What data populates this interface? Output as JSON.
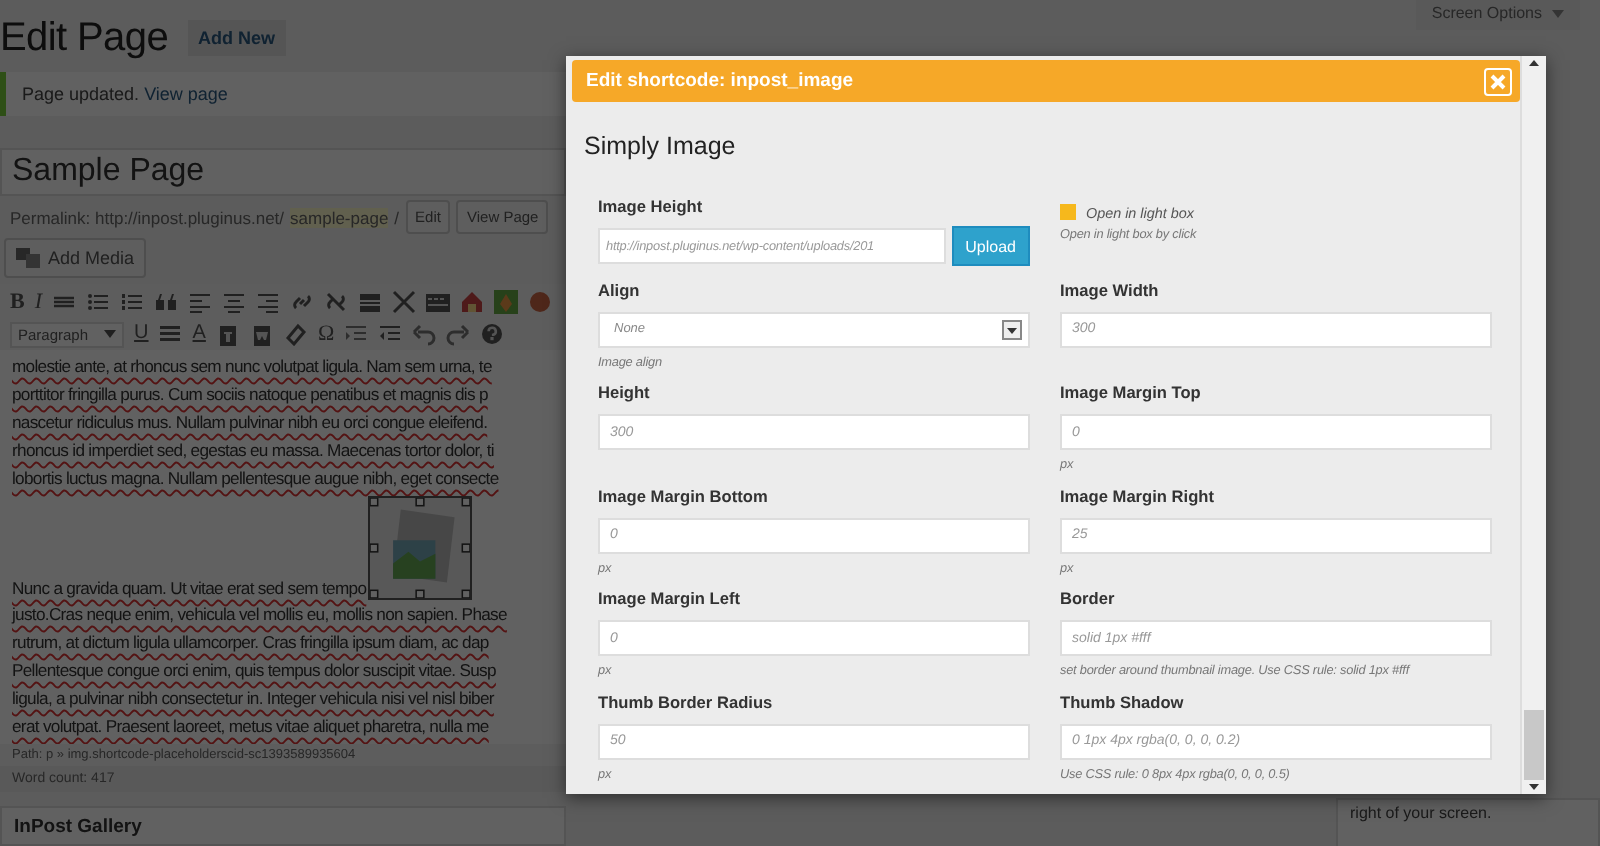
{
  "header": {
    "title": "Edit Page",
    "add_new": "Add New",
    "screen_options": "Screen Options"
  },
  "notice": {
    "text": "Page updated.",
    "link": "View page"
  },
  "post_title": "Sample Page",
  "permalink": {
    "label": "Permalink: http://inpost.pluginus.net/",
    "slug": "sample-page",
    "trail": "/",
    "buttons": [
      "Edit",
      "View Page"
    ]
  },
  "add_media": "Add Media",
  "toolbar": {
    "bold": "B",
    "italic": "I",
    "format_select": "Paragraph",
    "underline": "U",
    "text_color": "A",
    "special_char": "Ω"
  },
  "editor_paragraphs": [
    [
      "molestie ante, at rhoncus sem nunc volutpat ligula. Nam sem urna, te",
      "porttitor fringilla purus. Cum sociis natoque penatibus et magnis dis p",
      "nascetur ridiculus mus. Nullam pulvinar nibh eu orci congue eleifend.",
      "rhoncus id imperdiet sed, egestas eu massa. Maecenas tortor dolor, ti",
      "lobortis luctus magna. Nullam pellentesque augue nibh, eget consecte"
    ],
    [
      "Nunc a gravida quam. Ut vitae erat sed sem tempo",
      "justo.Cras neque enim, vehicula vel mollis eu, mollis non sapien. Phase",
      "rutrum, at dictum ligula ullamcorper. Cras fringilla ipsum diam, ac dap",
      "Pellentesque congue orci enim, quis tempus dolor suscipit vitae. Susp",
      "ligula, a pulvinar nibh consectetur in. Integer vehicula nisi vel nisl biber",
      "erat volutpat. Praesent laoreet, metus vitae aliquet pharetra, nulla me"
    ]
  ],
  "path": "Path: p » img.shortcode-placeholderscid-sc1393589935604",
  "word_count": "Word count: 417",
  "gallery_box": "InPost Gallery",
  "side_note": "right of your screen.",
  "modal": {
    "title": "Edit shortcode: inpost_image",
    "heading": "Simply Image",
    "fields": [
      {
        "kind": "upload",
        "label": "Image Height",
        "placeholder": "http://inpost.pluginus.net/wp-content/uploads/201",
        "button": "Upload"
      },
      {
        "kind": "checkbox",
        "label": "Open in light box",
        "checked": true,
        "hint": "Open in light box by click"
      },
      {
        "kind": "select",
        "label": "Align",
        "value": "None",
        "hint": "Image align"
      },
      {
        "kind": "text",
        "label": "Image Width",
        "placeholder": "300"
      },
      {
        "kind": "text",
        "label": "Height",
        "placeholder": "300"
      },
      {
        "kind": "text",
        "label": "Image Margin Top",
        "placeholder": "0",
        "hint": "px"
      },
      {
        "kind": "text",
        "label": "Image Margin Bottom",
        "placeholder": "0",
        "hint": "px"
      },
      {
        "kind": "text",
        "label": "Image Margin Right",
        "placeholder": "25",
        "hint": "px"
      },
      {
        "kind": "text",
        "label": "Image Margin Left",
        "placeholder": "0",
        "hint": "px"
      },
      {
        "kind": "text",
        "label": "Border",
        "placeholder": "solid 1px #fff",
        "hint": "set border around thumbnail image. Use CSS rule: solid 1px #fff"
      },
      {
        "kind": "text",
        "label": "Thumb Border Radius",
        "placeholder": "50",
        "hint": "px"
      },
      {
        "kind": "text",
        "label": "Thumb Shadow",
        "placeholder": "0 1px 4px rgba(0, 0, 0, 0.2)",
        "hint": "Use CSS rule: 0 8px 4px rgba(0, 0, 0, 0.5)"
      }
    ]
  }
}
